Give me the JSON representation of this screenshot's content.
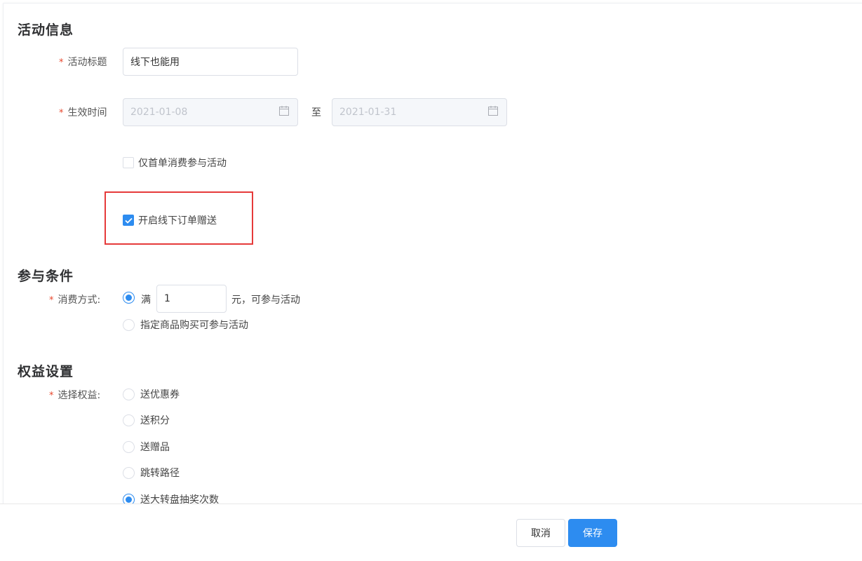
{
  "activity_info": {
    "title": "活动信息",
    "activity_title_label": "活动标题",
    "activity_title_value": "线下也能用",
    "effective_time_label": "生效时间",
    "start_date": "2021-01-08",
    "to_text": "至",
    "end_date": "2021-01-31",
    "first_order_only_label": "仅首单消费参与活动",
    "first_order_only_checked": false,
    "offline_order_label": "开启线下订单赠送",
    "offline_order_checked": true
  },
  "conditions": {
    "title": "参与条件",
    "consume_method_label": "消费方式:",
    "option_full_prefix": "满",
    "option_full_amount": "1",
    "option_full_suffix": "元，可参与活动",
    "option_specified_goods": "指定商品购买可参与活动",
    "selected": "full"
  },
  "benefits": {
    "title": "权益设置",
    "select_label": "选择权益:",
    "options": [
      "送优惠券",
      "送积分",
      "送赠品",
      "跳转路径",
      "送大转盘抽奖次数"
    ],
    "selected_index": 4
  },
  "footer": {
    "cancel_label": "取消",
    "save_label": "保存"
  },
  "colors": {
    "accent": "#2d8cf0",
    "required": "#e8472d",
    "highlight": "#e63a3a"
  },
  "icons": {
    "date": "calendar-icon",
    "check": "checkmark-icon"
  }
}
